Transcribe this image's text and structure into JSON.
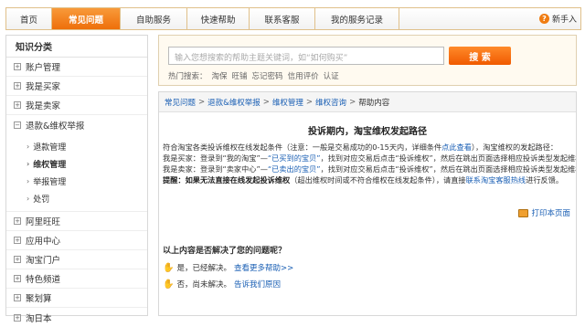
{
  "nav": {
    "tabs": [
      {
        "label": "首页"
      },
      {
        "label": "常见问题"
      },
      {
        "label": "自助服务"
      },
      {
        "label": "快速帮助"
      },
      {
        "label": "联系客服"
      },
      {
        "label": "我的服务记录"
      }
    ],
    "newbie_label": "新手入"
  },
  "sidebar": {
    "title": "知识分类",
    "items_top": [
      "账户管理",
      "我是买家",
      "我是卖家"
    ],
    "expanded": {
      "label": "退款&维权举报",
      "subs": [
        "退款管理",
        "维权管理",
        "举报管理",
        "处罚"
      ]
    },
    "items_bottom": [
      "阿里旺旺",
      "应用中心",
      "淘宝门户",
      "特色频道",
      "聚划算",
      "淘日本"
    ]
  },
  "search": {
    "placeholder": "输入您想搜索的帮助主题关键词，如“如何购买”",
    "button_label": "搜 索",
    "hot_label": "热门搜索：",
    "hot_keywords": [
      "淘保",
      "旺铺",
      "忘记密码",
      "信用评价",
      "认证"
    ]
  },
  "breadcrumb": [
    "常见问题",
    "退款&维权举报",
    "维权管理",
    "维权咨询",
    "帮助内容"
  ],
  "article": {
    "title": "投诉期内，淘宝维权发起路径",
    "line1_a": "符合淘宝各类投诉维权在线发起条件（注意：一般是交易成功的0-15天内，详细条件",
    "line1_link": "点此查看",
    "line1_b": "），淘宝维权的发起路径：",
    "line2_a": "我是买家：登录到“我的淘宝”—",
    "line2_link": "“已买到的宝贝”",
    "line2_b": "，找到对应交易后点击“投诉维权”，然后在跳出页面选择相应投诉类型发起维权。",
    "line3_a": "我是卖家：登录到“卖家中心”—",
    "line3_link": "“已卖出的宝贝”",
    "line3_b": "，找到对应交易后点击“投诉维权”，然后在跳出页面选择相应投诉类型发起维权。",
    "line4_warn": "提醒：如果无法直接在线发起投诉维权",
    "line4_a": "（超出维权时间或不符合维权在线发起条件），请直接",
    "line4_link": "联系淘宝客服热线",
    "line4_b": "进行反馈。"
  },
  "print_label": "打印本页面",
  "feedback": {
    "question": "以上内容是否解决了您的问题呢？",
    "yes_text": "是，已经解决。",
    "yes_link": "查看更多帮助>>",
    "no_text": "否，尚未解决。",
    "no_link": "告诉我们原因"
  }
}
